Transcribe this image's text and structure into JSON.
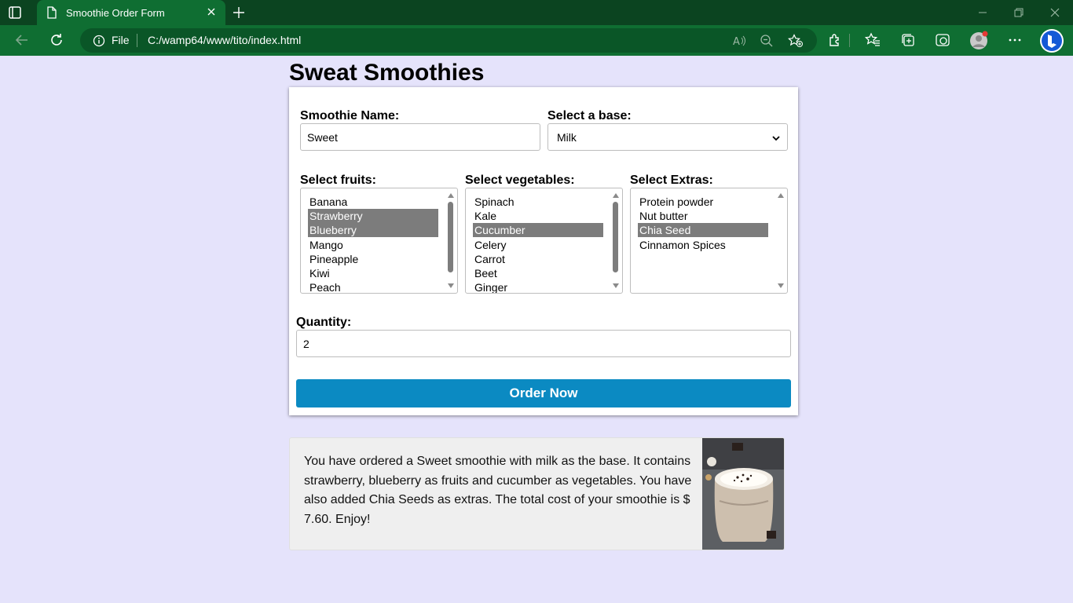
{
  "browser": {
    "tab_title": "Smoothie Order Form",
    "address_scheme": "File",
    "address_url": "C:/wamp64/www/tito/index.html",
    "colors": {
      "titlebar": "#0b4420",
      "toolbar": "#0f6e32",
      "omnibox": "#0a5627"
    }
  },
  "page": {
    "title": "Sweat Smoothies",
    "background": "#e5e3fb"
  },
  "form": {
    "name_label": "Smoothie Name:",
    "name_value": "Sweet",
    "base_label": "Select a base:",
    "base_value": "Milk",
    "fruits_label": "Select fruits:",
    "fruits": [
      {
        "label": "Banana",
        "selected": false
      },
      {
        "label": "Strawberry",
        "selected": true
      },
      {
        "label": "Blueberry",
        "selected": true
      },
      {
        "label": "Mango",
        "selected": false
      },
      {
        "label": "Pineapple",
        "selected": false
      },
      {
        "label": "Kiwi",
        "selected": false
      },
      {
        "label": "Peach",
        "selected": false
      }
    ],
    "vegetables_label": "Select vegetables:",
    "vegetables": [
      {
        "label": "Spinach",
        "selected": false
      },
      {
        "label": "Kale",
        "selected": false
      },
      {
        "label": "Cucumber",
        "selected": true
      },
      {
        "label": "Celery",
        "selected": false
      },
      {
        "label": "Carrot",
        "selected": false
      },
      {
        "label": "Beet",
        "selected": false
      },
      {
        "label": "Ginger",
        "selected": false
      }
    ],
    "extras_label": "Select Extras:",
    "extras": [
      {
        "label": "Protein powder",
        "selected": false
      },
      {
        "label": "Nut butter",
        "selected": false
      },
      {
        "label": "Chia Seed",
        "selected": true
      },
      {
        "label": "Cinnamon Spices",
        "selected": false
      }
    ],
    "quantity_label": "Quantity:",
    "quantity_value": "2",
    "submit_label": "Order Now",
    "accent_color": "#0b8ac2"
  },
  "summary": {
    "message": "You have ordered a Sweet smoothie with milk as the base. It contains strawberry, blueberry as fruits and cucumber as vegetables. You have also added Chia Seeds as extras. The total cost of your smoothie is $ 7.60. Enjoy!",
    "image_icon": "smoothie-photo"
  }
}
